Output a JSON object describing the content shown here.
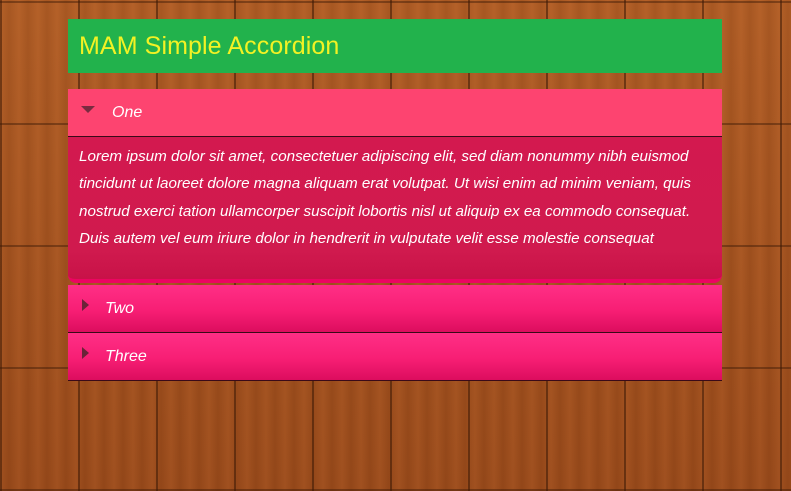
{
  "title": "MAM Simple Accordion",
  "panels": [
    {
      "label": "One",
      "content": "Lorem ipsum dolor sit amet, consectetuer adipiscing elit, sed diam nonummy nibh euismod tincidunt ut laoreet dolore magna aliquam erat volutpat. Ut wisi enim ad minim veniam, quis nostrud exerci tation ullamcorper suscipit lobortis nisl ut aliquip ex ea commodo consequat. Duis autem vel eum iriure dolor in hendrerit in vulputate velit esse molestie consequat"
    },
    {
      "label": "Two"
    },
    {
      "label": "Three"
    }
  ],
  "colors": {
    "header_bg": "#22b24c",
    "title_text": "#f2f224",
    "panel_bg": "#f71e74",
    "open_panel_bg": "#fd4470",
    "body_bg": "#d3194f"
  }
}
